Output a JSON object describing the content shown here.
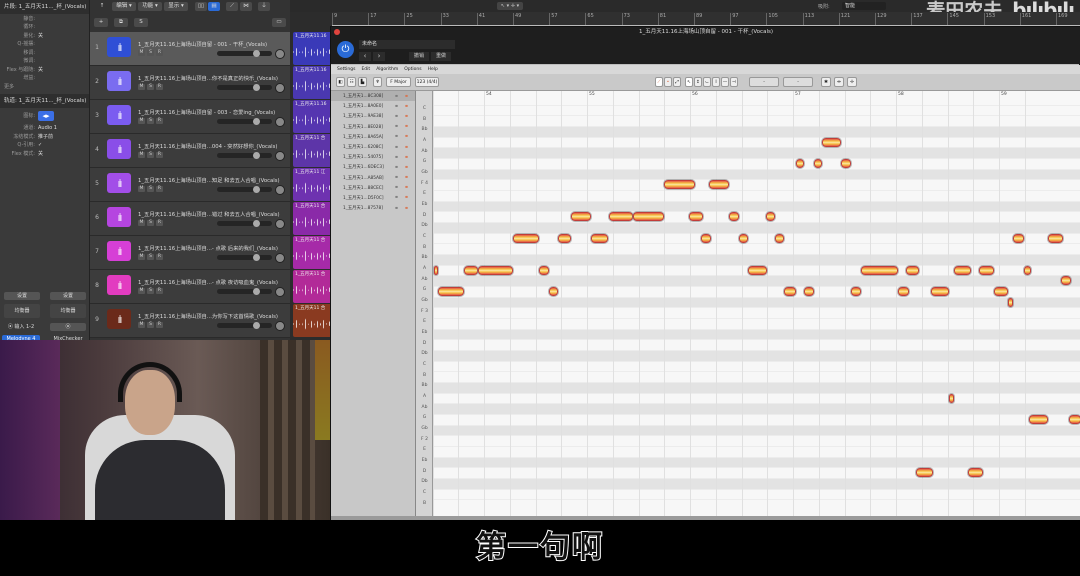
{
  "inspector": {
    "region_header": "片段: 1_五月天11..._杯_(Vocals)",
    "region_rows": [
      {
        "k": "静音:",
        "v": ""
      },
      {
        "k": "循环:",
        "v": ""
      },
      {
        "k": "量化:",
        "v": "关"
      },
      {
        "k": "Q-摇摆:",
        "v": ""
      },
      {
        "k": "移调:",
        "v": ""
      },
      {
        "k": "微调:",
        "v": ""
      },
      {
        "k": "Flex 与跟随:",
        "v": "关"
      },
      {
        "k": "增益:",
        "v": ""
      }
    ],
    "more": "更多",
    "track_header": "轨道: 1_五月天11..._杯_(Vocals)",
    "icon_label": "图标:",
    "track_rows": [
      {
        "k": "通道:",
        "v": "Audio 1"
      },
      {
        "k": "冻结模式:",
        "v": "推子前"
      },
      {
        "k": "Q-引用:",
        "v": "✓"
      },
      {
        "k": "Flex 模式:",
        "v": "关"
      }
    ],
    "strip": {
      "settings_l": "设置",
      "settings_r": "设置",
      "eq_l": "均衡器",
      "eq_r": "均衡器",
      "input_l": "⦿ 输入 1-2",
      "input_r": "⦿",
      "plugin_l": "Melodyne 4",
      "plugin_r": "MixChecker"
    }
  },
  "logic_toolbar": {
    "back": "↑",
    "edit": "编辑 ▾",
    "functions": "功能 ▾",
    "view": "显示 ▾",
    "add": "+",
    "dup": "⧉",
    "solo": "S",
    "snap_label": "吸附:",
    "snap_value": "智能"
  },
  "tracks": [
    {
      "num": "1",
      "name": "1_五月天11.16上海场山顶自留 - 001 - 干杯_(Vocals)",
      "color": "#2f4fd6",
      "region": "#3a3ab8",
      "region_label": "1_五月天11.16"
    },
    {
      "num": "2",
      "name": "1_五月天11.16上海场山顶自...你不是真正的快乐_(Vocals)",
      "color": "#7a6cf0",
      "region": "#4a38b0",
      "region_label": "1_五月天11.16"
    },
    {
      "num": "3",
      "name": "1_五月天11.16上海场山顶自留 - 003 - 恋爱ing_(Vocals)",
      "color": "#7b5cf0",
      "region": "#5535b0",
      "region_label": "1_五月天11.16"
    },
    {
      "num": "4",
      "name": "1_五月天11.16上海场山顶自...004 - 突然好想你_(Vocals)",
      "color": "#8a4ee8",
      "region": "#5d35a8",
      "region_label": "1_五月天11 合"
    },
    {
      "num": "5",
      "name": "1_五月天11.16上海场山顶自...知足 和去五人合唱_(Vocals)",
      "color": "#a24ee8",
      "region": "#6e32b0",
      "region_label": "1_五月天11 江"
    },
    {
      "num": "6",
      "name": "1_五月天11.16上海场山顶自...错过 和去五人合唱_(Vocals)",
      "color": "#b545e0",
      "region": "#8a2aa8",
      "region_label": "1_五月天11 合"
    },
    {
      "num": "7",
      "name": "1_五月天11.16上海场山顶自...- 点歌 后来的我们_(Vocals)",
      "color": "#d63fd6",
      "region": "#a62aa8",
      "region_label": "1_五月天11 合"
    },
    {
      "num": "8",
      "name": "1_五月天11.16上海场山顶自...- 点歌 夜访吸血鬼_(Vocals)",
      "color": "#e23cc0",
      "region": "#b22a98",
      "region_label": "1_五月天11 合"
    },
    {
      "num": "9",
      "name": "1_五月天11.16上海场山顶自...为你写下这首情歌_(Vocals)",
      "color": "#6b2a1a",
      "region": "#8a3a20",
      "region_label": "1_五月天11 合"
    }
  ],
  "track_buttons": {
    "m": "M",
    "s": "S",
    "r": "R"
  },
  "ruler": [
    "9",
    "17",
    "25",
    "33",
    "41",
    "49",
    "57",
    "65",
    "73",
    "81",
    "89",
    "97",
    "105",
    "113",
    "121",
    "129",
    "137",
    "145",
    "153",
    "161",
    "169"
  ],
  "melodyne": {
    "title": "1_五月天11.16上海场山顶自留 - 001 - 干杯_(Vocals)",
    "preset": "未命名",
    "prev": "‹",
    "next": "›",
    "undo": "撤销",
    "redo": "重做",
    "menu": [
      "Settings",
      "Edit",
      "Algorithm",
      "Options",
      "Help"
    ],
    "key": "F Major",
    "grid_setting": "123 (4/4)",
    "field1": "-",
    "field2": "-",
    "blobs": [
      "1_五月天1...8C308]",
      "1_五月天1...8A0E0]",
      "1_五月天1...9AE38]",
      "1_五月天1...8E028]",
      "1_五月天1...8A65A]",
      "1_五月天1...6208C]",
      "1_五月天1...54075]",
      "1_五月天1...6DEC3]",
      "1_五月天1...A85AB]",
      "1_五月天1...88CEC]",
      "1_五月天1...D5F0C]",
      "1_五月天1...87578]"
    ],
    "pitch_labels": [
      "C",
      "B",
      "Bb",
      "A",
      "Ab",
      "G",
      "Gb",
      "F 4",
      "E",
      "Eb",
      "D",
      "Db",
      "C",
      "B",
      "Bb",
      "A",
      "Ab",
      "G",
      "Gb",
      "F 3",
      "E",
      "Eb",
      "D",
      "Db",
      "C",
      "B",
      "Bb",
      "A",
      "Ab",
      "G",
      "Gb",
      "F 2",
      "E",
      "Eb",
      "D",
      "Db",
      "C",
      "B"
    ],
    "bars": [
      "54",
      "55",
      "56",
      "57",
      "58",
      "59"
    ]
  },
  "chart_data": {
    "type": "scatter",
    "title": "Melodyne note blobs (start bar, end bar, MIDI pitch)",
    "x_range_bars": [
      53.5,
      59.8
    ],
    "y_range_midi": [
      35,
      72
    ],
    "notes": [
      [
        53.51,
        53.55,
        57
      ],
      [
        53.55,
        53.81,
        55
      ],
      [
        53.81,
        53.94,
        57
      ],
      [
        53.94,
        54.28,
        57
      ],
      [
        54.28,
        54.53,
        60
      ],
      [
        54.53,
        54.63,
        57
      ],
      [
        54.63,
        54.72,
        55
      ],
      [
        54.72,
        54.84,
        60
      ],
      [
        54.84,
        55.04,
        62
      ],
      [
        55.04,
        55.2,
        60
      ],
      [
        55.21,
        55.45,
        62
      ],
      [
        55.45,
        55.75,
        62
      ],
      [
        55.75,
        56.05,
        65
      ],
      [
        55.99,
        56.13,
        62
      ],
      [
        56.11,
        56.2,
        60
      ],
      [
        56.18,
        56.38,
        65
      ],
      [
        56.38,
        56.48,
        62
      ],
      [
        56.48,
        56.56,
        60
      ],
      [
        56.56,
        56.75,
        57
      ],
      [
        56.74,
        56.83,
        62
      ],
      [
        56.83,
        56.91,
        60
      ],
      [
        56.91,
        57.03,
        55
      ],
      [
        57.03,
        57.11,
        67
      ],
      [
        57.11,
        57.2,
        55
      ],
      [
        57.2,
        57.28,
        67
      ],
      [
        57.28,
        57.47,
        69
      ],
      [
        57.47,
        57.56,
        67
      ],
      [
        57.56,
        57.66,
        55
      ],
      [
        57.66,
        58.02,
        57
      ],
      [
        58.02,
        58.13,
        55
      ],
      [
        58.1,
        58.22,
        57
      ],
      [
        58.19,
        58.36,
        38
      ],
      [
        58.34,
        58.51,
        55
      ],
      [
        58.51,
        58.56,
        45
      ],
      [
        58.56,
        58.73,
        57
      ],
      [
        58.7,
        58.84,
        38
      ],
      [
        58.81,
        58.95,
        57
      ],
      [
        58.95,
        59.09,
        55
      ],
      [
        59.09,
        59.14,
        54
      ],
      [
        59.14,
        59.24,
        60
      ],
      [
        59.24,
        59.31,
        57
      ],
      [
        59.29,
        59.48,
        43
      ],
      [
        59.48,
        59.62,
        60
      ],
      [
        59.6,
        59.7,
        56
      ],
      [
        59.68,
        59.8,
        43
      ]
    ]
  },
  "watermark": {
    "channel": "麦田农夫",
    "logo": "bilibili"
  },
  "subtitle": "第一句啊"
}
